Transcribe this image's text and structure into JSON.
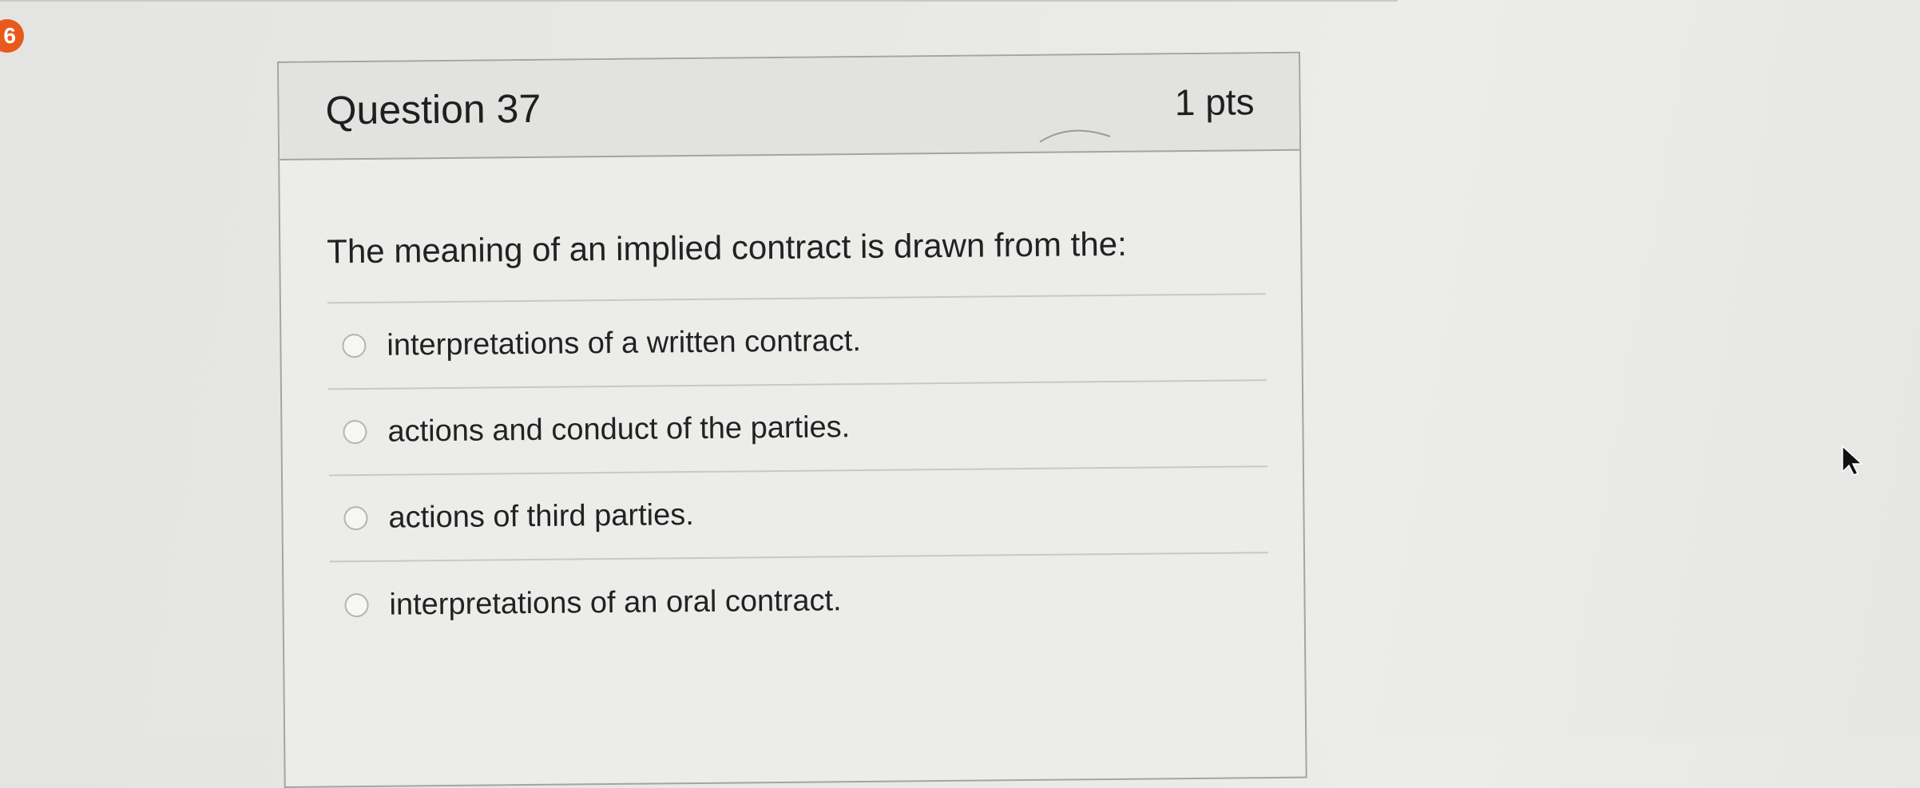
{
  "badge": {
    "number": "6"
  },
  "question": {
    "title": "Question 37",
    "points": "1 pts",
    "prompt": "The meaning of an implied contract is drawn from the:",
    "answers": [
      {
        "label": "interpretations of a written contract."
      },
      {
        "label": "actions and conduct of the parties."
      },
      {
        "label": "actions of third parties."
      },
      {
        "label": "interpretations of an oral contract."
      }
    ]
  },
  "colors": {
    "badge": "#e85a1b",
    "header_bg": "#e2e2e0",
    "border": "#a4a4a2",
    "text": "#222222"
  },
  "icons": {
    "radio": "radio-button-icon",
    "cursor": "mouse-pointer-icon"
  }
}
